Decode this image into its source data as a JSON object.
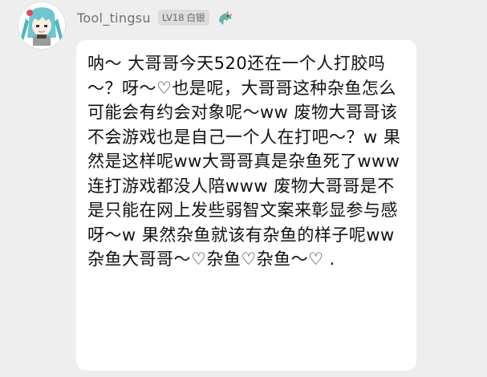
{
  "user": {
    "avatar_icon": "anime-character-avatar",
    "username": "Tool_tingsu",
    "level_badge": {
      "level": "LV18",
      "rank": "白银"
    },
    "emblem_icon": "dragon-emblem-icon"
  },
  "message": {
    "text": "呐～ 大哥哥今天520还在一个人打胶吗～？呀～♡也是呢，大哥哥这种杂鱼怎么可能会有约会对象呢～ww 废物大哥哥该不会游戏也是自己一个人在打吧～？w 果然是这样呢ww大哥哥真是杂鱼死了www 连打游戏都没人陪www 废物大哥哥是不是只能在网上发些弱智文案来彰显参与感呀～w 果然杂鱼就该有杂鱼的样子呢ww 杂鱼大哥哥～♡杂鱼♡杂鱼～♡ ."
  },
  "colors": {
    "background": "#eeeeee",
    "bubble": "#ffffff",
    "text": "#111111",
    "username": "#6f6f6f",
    "badge_bg": "#dcdcdc"
  }
}
